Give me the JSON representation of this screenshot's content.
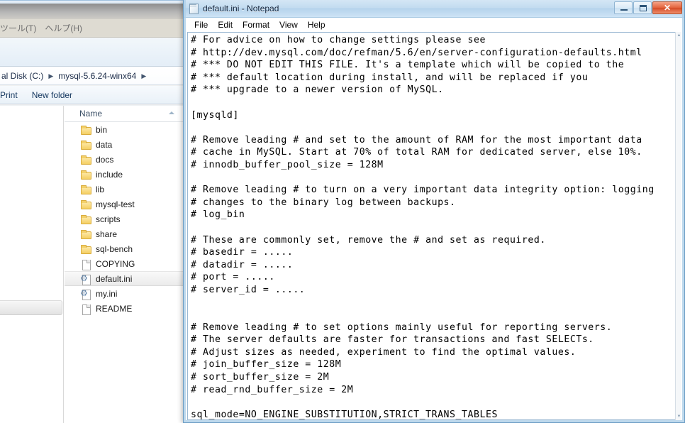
{
  "explorer": {
    "menu_items": [
      "ツール(T)",
      "ヘルプ(H)"
    ],
    "breadcrumb": {
      "items": [
        "al Disk (C:)",
        "mysql-5.6.24-winx64"
      ],
      "separator": "▶"
    },
    "toolbar": {
      "print_label": "Print",
      "new_folder_label": "New folder"
    },
    "file_list": {
      "column_header": "Name",
      "rows": [
        {
          "name": "bin",
          "icon": "folder-icon",
          "selected": false
        },
        {
          "name": "data",
          "icon": "folder-icon",
          "selected": false
        },
        {
          "name": "docs",
          "icon": "folder-icon",
          "selected": false
        },
        {
          "name": "include",
          "icon": "folder-icon",
          "selected": false
        },
        {
          "name": "lib",
          "icon": "folder-icon",
          "selected": false
        },
        {
          "name": "mysql-test",
          "icon": "folder-icon",
          "selected": false
        },
        {
          "name": "scripts",
          "icon": "folder-icon",
          "selected": false
        },
        {
          "name": "share",
          "icon": "folder-icon",
          "selected": false
        },
        {
          "name": "sql-bench",
          "icon": "folder-icon",
          "selected": false
        },
        {
          "name": "COPYING",
          "icon": "file-icon",
          "selected": false
        },
        {
          "name": "default.ini",
          "icon": "ini-file-icon",
          "selected": true
        },
        {
          "name": "my.ini",
          "icon": "ini-file-icon",
          "selected": false
        },
        {
          "name": "README",
          "icon": "file-icon",
          "selected": false
        }
      ]
    }
  },
  "notepad": {
    "title": "default.ini - Notepad",
    "app_icon": "notepad-icon",
    "menus": [
      "File",
      "Edit",
      "Format",
      "View",
      "Help"
    ],
    "window_buttons": {
      "minimize": "–",
      "maximize": "❐",
      "close": "✕"
    },
    "scrollbar": {
      "up_arrow": "▲",
      "down_arrow": "▼"
    },
    "document_text": "# For advice on how to change settings please see\n# http://dev.mysql.com/doc/refman/5.6/en/server-configuration-defaults.html\n# *** DO NOT EDIT THIS FILE. It's a template which will be copied to the\n# *** default location during install, and will be replaced if you\n# *** upgrade to a newer version of MySQL.\n\n[mysqld]\n\n# Remove leading # and set to the amount of RAM for the most important data\n# cache in MySQL. Start at 70% of total RAM for dedicated server, else 10%.\n# innodb_buffer_pool_size = 128M\n\n# Remove leading # to turn on a very important data integrity option: logging\n# changes to the binary log between backups.\n# log_bin\n\n# These are commonly set, remove the # and set as required.\n# basedir = .....\n# datadir = .....\n# port = .....\n# server_id = .....\n\n\n# Remove leading # to set options mainly useful for reporting servers.\n# The server defaults are faster for transactions and fast SELECTs.\n# Adjust sizes as needed, experiment to find the optimal values.\n# join_buffer_size = 128M\n# sort_buffer_size = 2M\n# read_rnd_buffer_size = 2M\n\nsql_mode=NO_ENGINE_SUBSTITUTION,STRICT_TRANS_TABLES\n"
  },
  "colors": {
    "notepad_title_accent": "#b5d3ec",
    "close_button": "#d44a26",
    "explorer_menu_strip": "#b6b6b6",
    "folder_icon": "#f5cf63"
  }
}
